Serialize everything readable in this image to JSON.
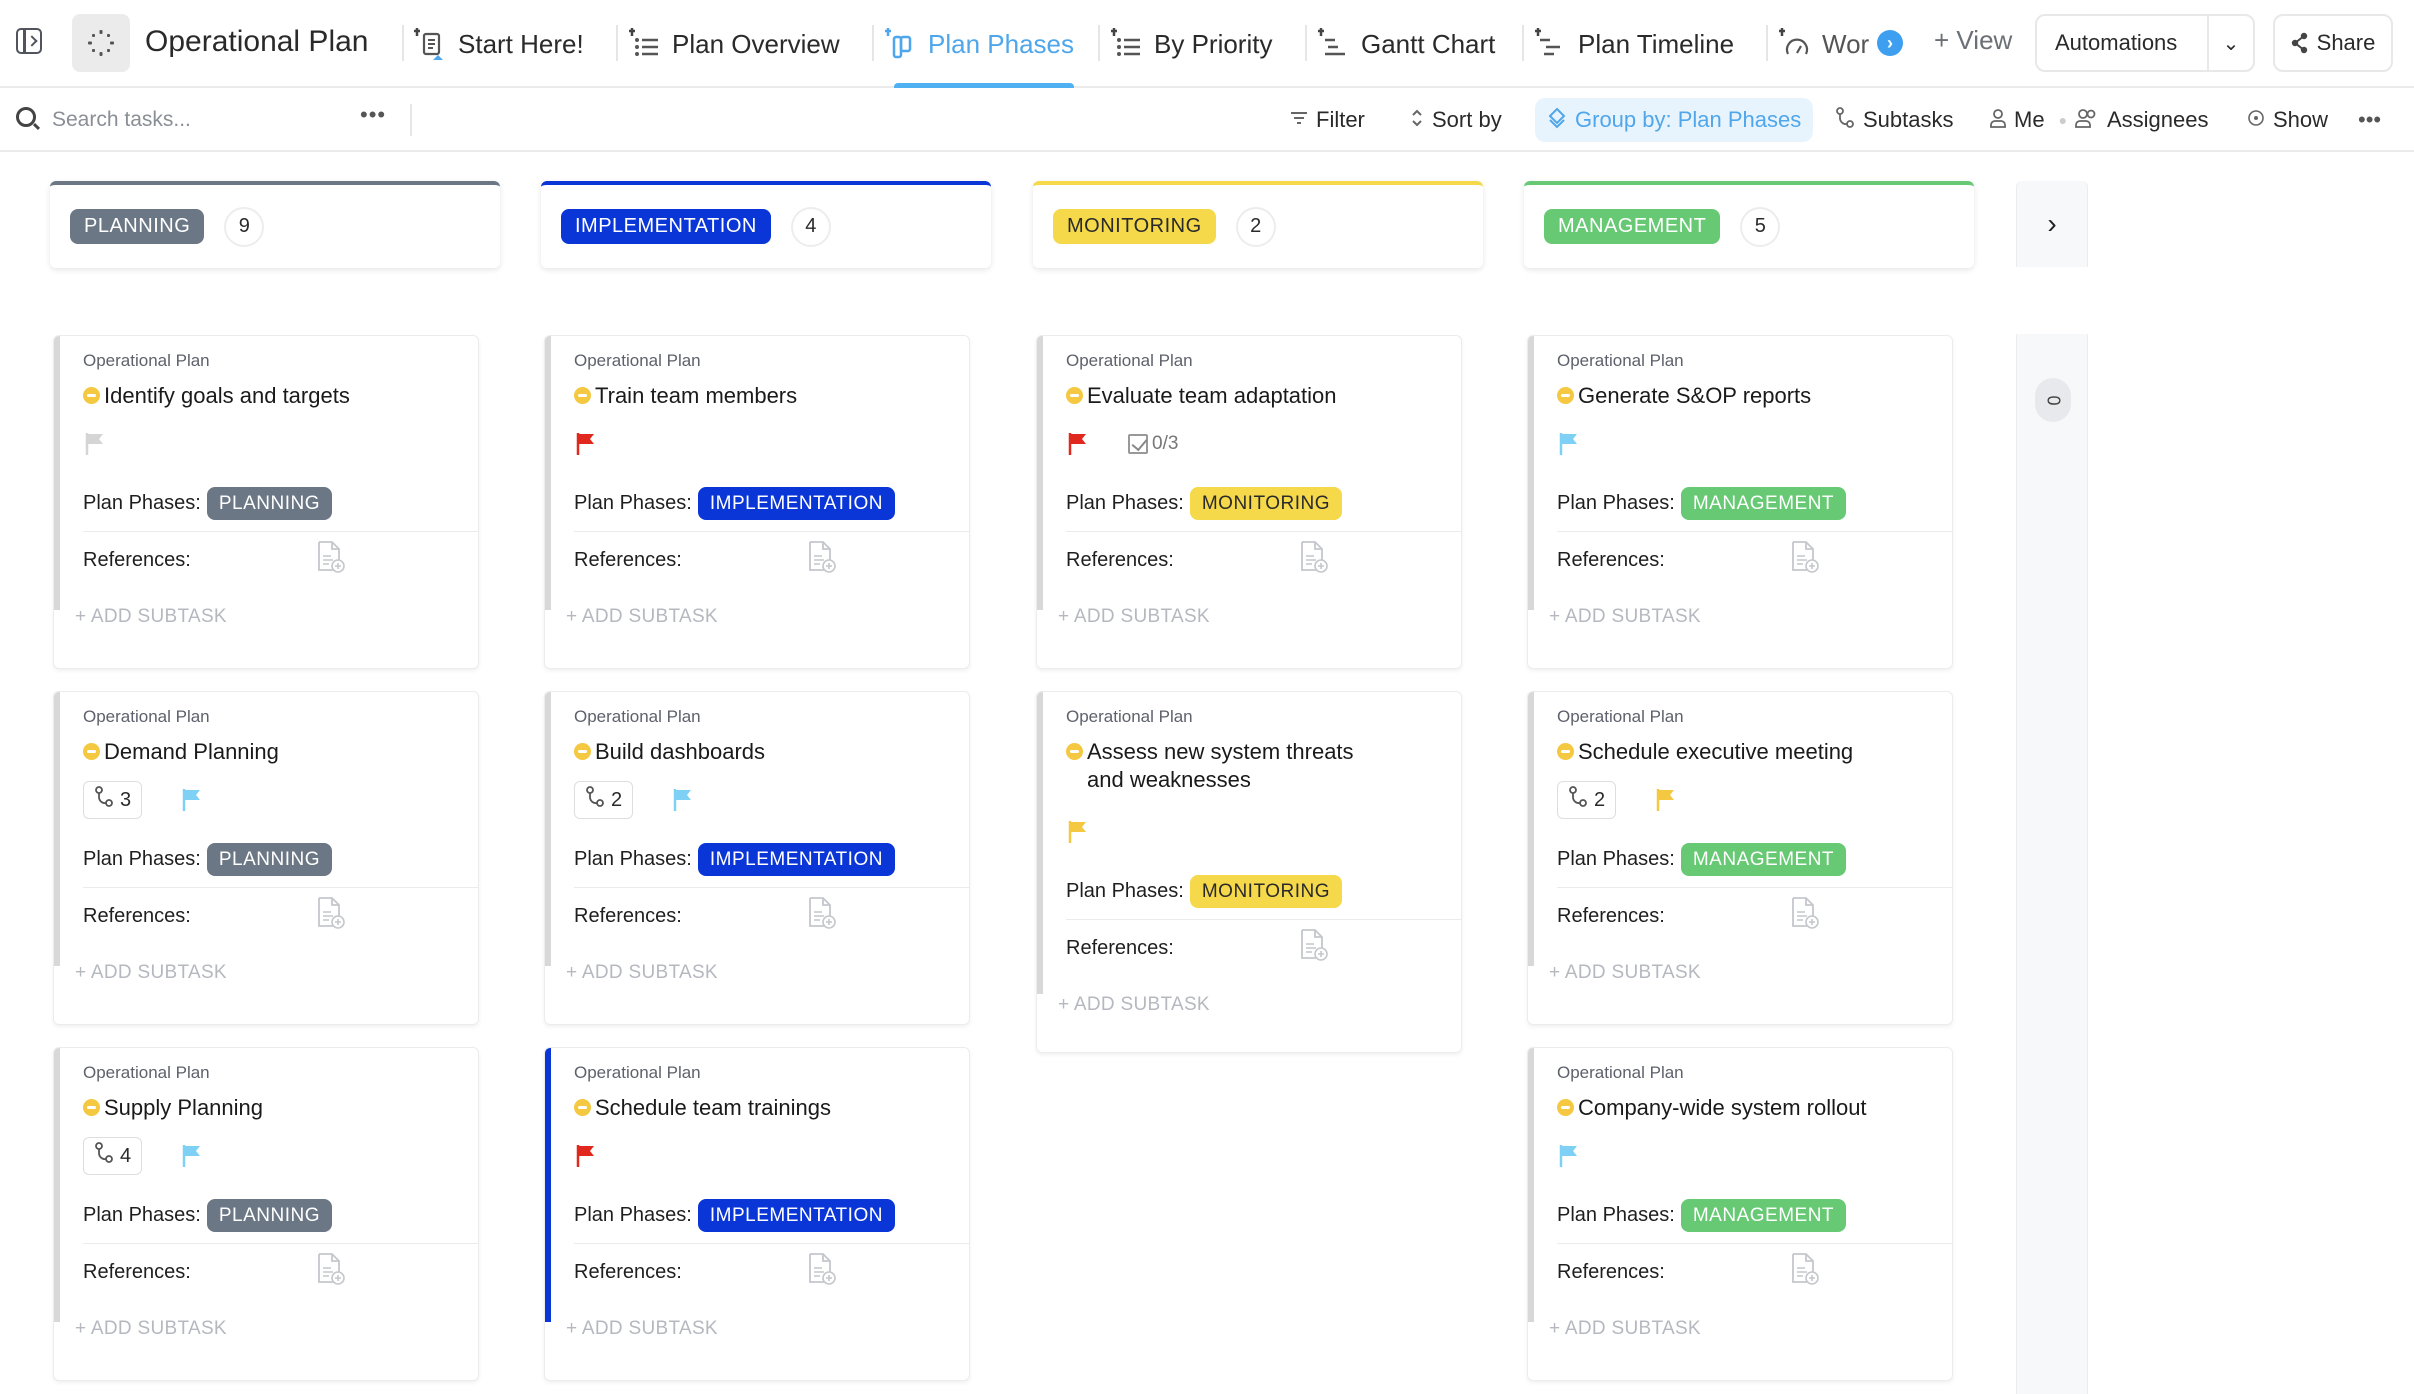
{
  "header": {
    "title": "Operational Plan",
    "tabs": [
      {
        "label": "Start Here!",
        "icon": "doc-home-icon",
        "active": false
      },
      {
        "label": "Plan Overview",
        "icon": "list-icon",
        "active": false
      },
      {
        "label": "Plan Phases",
        "icon": "board-icon",
        "active": true
      },
      {
        "label": "By Priority",
        "icon": "list-icon",
        "active": false
      },
      {
        "label": "Gantt Chart",
        "icon": "gantt-icon",
        "active": false
      },
      {
        "label": "Plan Timeline",
        "icon": "timeline-icon",
        "active": false
      },
      {
        "label": "Wor",
        "icon": "workload-icon",
        "active": false
      }
    ],
    "add_view_label": "View",
    "automations_label": "Automations",
    "share_label": "Share"
  },
  "toolbar": {
    "search_placeholder": "Search tasks...",
    "filter_label": "Filter",
    "sort_label": "Sort by",
    "group_label": "Group by: Plan Phases",
    "subtasks_label": "Subtasks",
    "me_label": "Me",
    "assignees_label": "Assignees",
    "show_label": "Show"
  },
  "colors": {
    "planning": "#6b7785",
    "implementation": "#0a36d8",
    "monitoring": "#f5d94a",
    "management": "#67c974",
    "accent": "#4fa6ea",
    "flag_red": "#e0281e",
    "flag_blue": "#7fd0f5",
    "flag_yellow": "#f5c842",
    "flag_gray": "#d5d5d5"
  },
  "columns": [
    {
      "name": "PLANNING",
      "count": "9",
      "key": "planning",
      "cards": [
        {
          "list": "Operational Plan",
          "title": "Identify goals and targets",
          "subtasks": null,
          "checklist": null,
          "flag": "gray",
          "phase_label": "Plan Phases:",
          "phase": "PLANNING",
          "refs_label": "References:",
          "add_subtask": "+ ADD SUBTASK"
        },
        {
          "list": "Operational Plan",
          "title": "Demand Planning",
          "subtasks": "3",
          "checklist": null,
          "flag": "blue",
          "phase_label": "Plan Phases:",
          "phase": "PLANNING",
          "refs_label": "References:",
          "add_subtask": "+ ADD SUBTASK"
        },
        {
          "list": "Operational Plan",
          "title": "Supply Planning",
          "subtasks": "4",
          "checklist": null,
          "flag": "blue",
          "phase_label": "Plan Phases:",
          "phase": "PLANNING",
          "refs_label": "References:",
          "add_subtask": "+ ADD SUBTASK"
        }
      ]
    },
    {
      "name": "IMPLEMENTATION",
      "count": "4",
      "key": "implementation",
      "cards": [
        {
          "list": "Operational Plan",
          "title": "Train team members",
          "subtasks": null,
          "checklist": null,
          "flag": "red",
          "phase_label": "Plan Phases:",
          "phase": "IMPLEMENTATION",
          "refs_label": "References:",
          "add_subtask": "+ ADD SUBTASK"
        },
        {
          "list": "Operational Plan",
          "title": "Build dashboards",
          "subtasks": "2",
          "checklist": null,
          "flag": "blue",
          "phase_label": "Plan Phases:",
          "phase": "IMPLEMENTATION",
          "refs_label": "References:",
          "add_subtask": "+ ADD SUBTASK"
        },
        {
          "list": "Operational Plan",
          "title": "Schedule team trainings",
          "subtasks": null,
          "checklist": null,
          "flag": "red",
          "phase_label": "Plan Phases:",
          "phase": "IMPLEMENTATION",
          "refs_label": "References:",
          "add_subtask": "+ ADD SUBTASK",
          "selected": true
        }
      ]
    },
    {
      "name": "MONITORING",
      "count": "2",
      "key": "monitoring",
      "cards": [
        {
          "list": "Operational Plan",
          "title": "Evaluate team adaptation",
          "subtasks": null,
          "checklist": "0/3",
          "flag": "red",
          "phase_label": "Plan Phases:",
          "phase": "MONITORING",
          "refs_label": "References:",
          "add_subtask": "+ ADD SUBTASK"
        },
        {
          "list": "Operational Plan",
          "title": "Assess new system threats and weaknesses",
          "subtasks": null,
          "checklist": null,
          "flag": "yellow",
          "phase_label": "Plan Phases:",
          "phase": "MONITORING",
          "refs_label": "References:",
          "add_subtask": "+ ADD SUBTASK"
        }
      ]
    },
    {
      "name": "MANAGEMENT",
      "count": "5",
      "key": "management",
      "cards": [
        {
          "list": "Operational Plan",
          "title": "Generate S&OP reports",
          "subtasks": null,
          "checklist": null,
          "flag": "blue",
          "phase_label": "Plan Phases:",
          "phase": "MANAGEMENT",
          "refs_label": "References:",
          "add_subtask": "+ ADD SUBTASK"
        },
        {
          "list": "Operational Plan",
          "title": "Schedule executive meeting",
          "subtasks": "2",
          "checklist": null,
          "flag": "yellow",
          "phase_label": "Plan Phases:",
          "phase": "MANAGEMENT",
          "refs_label": "References:",
          "add_subtask": "+ ADD SUBTASK"
        },
        {
          "list": "Operational Plan",
          "title": "Company-wide system rollout",
          "subtasks": null,
          "checklist": null,
          "flag": "blue",
          "phase_label": "Plan Phases:",
          "phase": "MANAGEMENT",
          "refs_label": "References:",
          "add_subtask": "+ ADD SUBTASK"
        }
      ]
    }
  ],
  "collapsed_column": {
    "count": "0"
  }
}
